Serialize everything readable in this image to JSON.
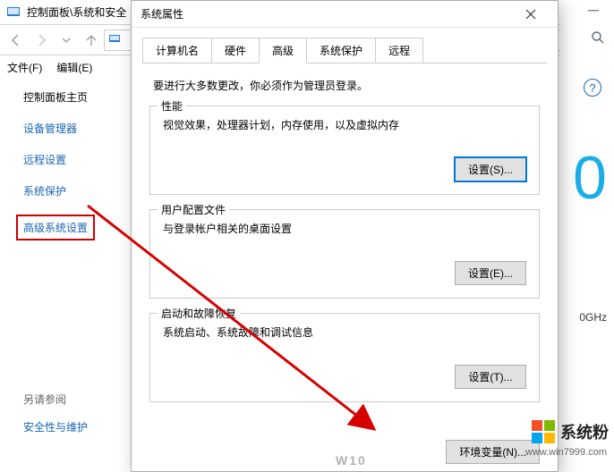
{
  "parent_window": {
    "title": "控制面板\\系统和安全"
  },
  "menubar": {
    "file": "文件(F)",
    "edit": "编辑(E)"
  },
  "sidebar": {
    "home": "控制面板主页",
    "items": [
      {
        "label": "设备管理器"
      },
      {
        "label": "远程设置"
      },
      {
        "label": "系统保护"
      },
      {
        "label": "高级系统设置"
      }
    ],
    "see_also_label": "另请参阅",
    "security_link": "安全性与维护"
  },
  "right": {
    "big_digit": "0",
    "ghz_fragment": "0GHz"
  },
  "dialog": {
    "title": "系统属性",
    "tabs": [
      {
        "label": "计算机名"
      },
      {
        "label": "硬件"
      },
      {
        "label": "高级"
      },
      {
        "label": "系统保护"
      },
      {
        "label": "远程"
      }
    ],
    "note": "要进行大多数更改，你必须作为管理员登录。",
    "groups": {
      "perf": {
        "legend": "性能",
        "desc": "视觉效果，处理器计划，内存使用，以及虚拟内存",
        "btn": "设置(S)..."
      },
      "profile": {
        "legend": "用户配置文件",
        "desc": "与登录帐户相关的桌面设置",
        "btn": "设置(E)..."
      },
      "startup": {
        "legend": "启动和故障恢复",
        "desc": "系统启动、系统故障和调试信息",
        "btn": "设置(T)..."
      }
    },
    "env_btn": "环境变量(N)...",
    "watermark": "W10"
  },
  "brand": {
    "text": "系统粉",
    "url": "www.win7999.com"
  }
}
